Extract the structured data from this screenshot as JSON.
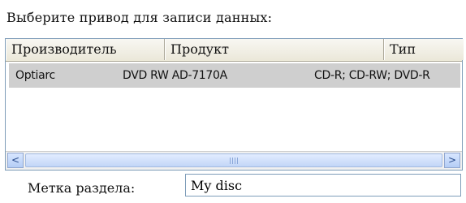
{
  "prompt": "Выберите привод для записи данных:",
  "drive_list": {
    "columns": [
      "Производитель",
      "Продукт",
      "Тип"
    ],
    "rows": [
      {
        "manufacturer": "Optiarc",
        "product": "DVD RW AD-7170A",
        "type": "CD-R; CD-RW; DVD-R"
      }
    ]
  },
  "scrollbar": {
    "left_icon": "arrow-left-icon",
    "right_icon": "arrow-right-icon",
    "left_glyph": "<",
    "right_glyph": ">"
  },
  "partition_label": {
    "label": "Метка раздела:",
    "value": "My disc"
  }
}
